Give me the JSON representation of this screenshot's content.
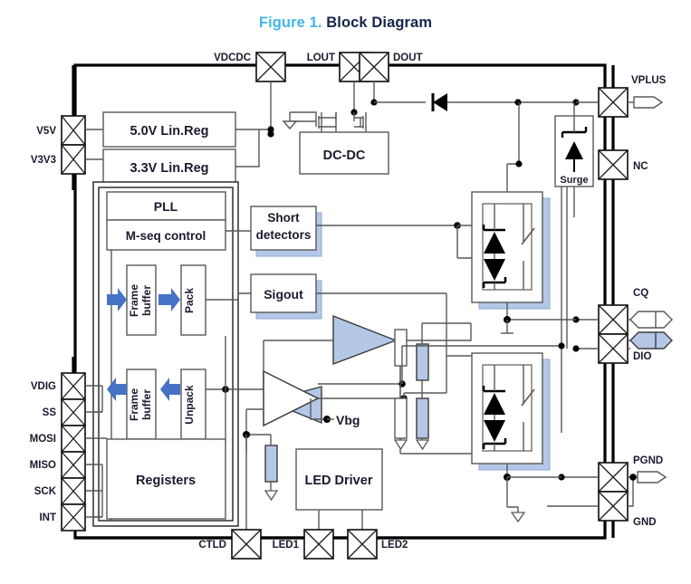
{
  "figure": {
    "number": "Figure 1.",
    "title": "Block Diagram"
  },
  "colors": {
    "fig_number": "#41b6e6",
    "title": "#14254a",
    "accent_fill": "#b4c7e7",
    "arrow_blue": "#4472c4",
    "shadow_blue": "#b4c7e7",
    "wire": "#595959",
    "frame": "#000000",
    "label": "#1a1a2e"
  },
  "pins": {
    "top": [
      {
        "name": "VDCDC"
      },
      {
        "name": "LOUT"
      },
      {
        "name": "DOUT"
      }
    ],
    "left": [
      {
        "name": "V5V"
      },
      {
        "name": "V3V3"
      }
    ],
    "left_lower": [
      {
        "name": "VDIG"
      },
      {
        "name": "SS"
      },
      {
        "name": "MOSI"
      },
      {
        "name": "MISO"
      },
      {
        "name": "SCK"
      },
      {
        "name": "INT"
      }
    ],
    "right": [
      {
        "name": "VPLUS"
      },
      {
        "name": "NC"
      },
      {
        "name": "CQ"
      },
      {
        "name": "DIO"
      },
      {
        "name": "PGND"
      },
      {
        "name": "GND"
      }
    ],
    "bottom": [
      {
        "name": "CTLD"
      },
      {
        "name": "LED1"
      },
      {
        "name": "LED2"
      }
    ]
  },
  "blocks": {
    "linreg5": "5.0V Lin.Reg",
    "linreg33": "3.3V Lin.Reg",
    "dcdc": "DC-DC",
    "surge": "Surge",
    "pll": "PLL",
    "mseq": "M-seq control",
    "frame_buffer_tx": "Frame\nbuffer",
    "frame_buffer_tx_l1": "Frame",
    "frame_buffer_tx_l2": "buffer",
    "pack": "Pack",
    "frame_buffer_rx_l1": "Frame",
    "frame_buffer_rx_l2": "buffer",
    "unpack": "Unpack",
    "registers": "Registers",
    "short_detectors_l1": "Short",
    "short_detectors_l2": "detectors",
    "sigout": "Sigout",
    "led_driver": "LED Driver",
    "vbg": "Vbg"
  }
}
